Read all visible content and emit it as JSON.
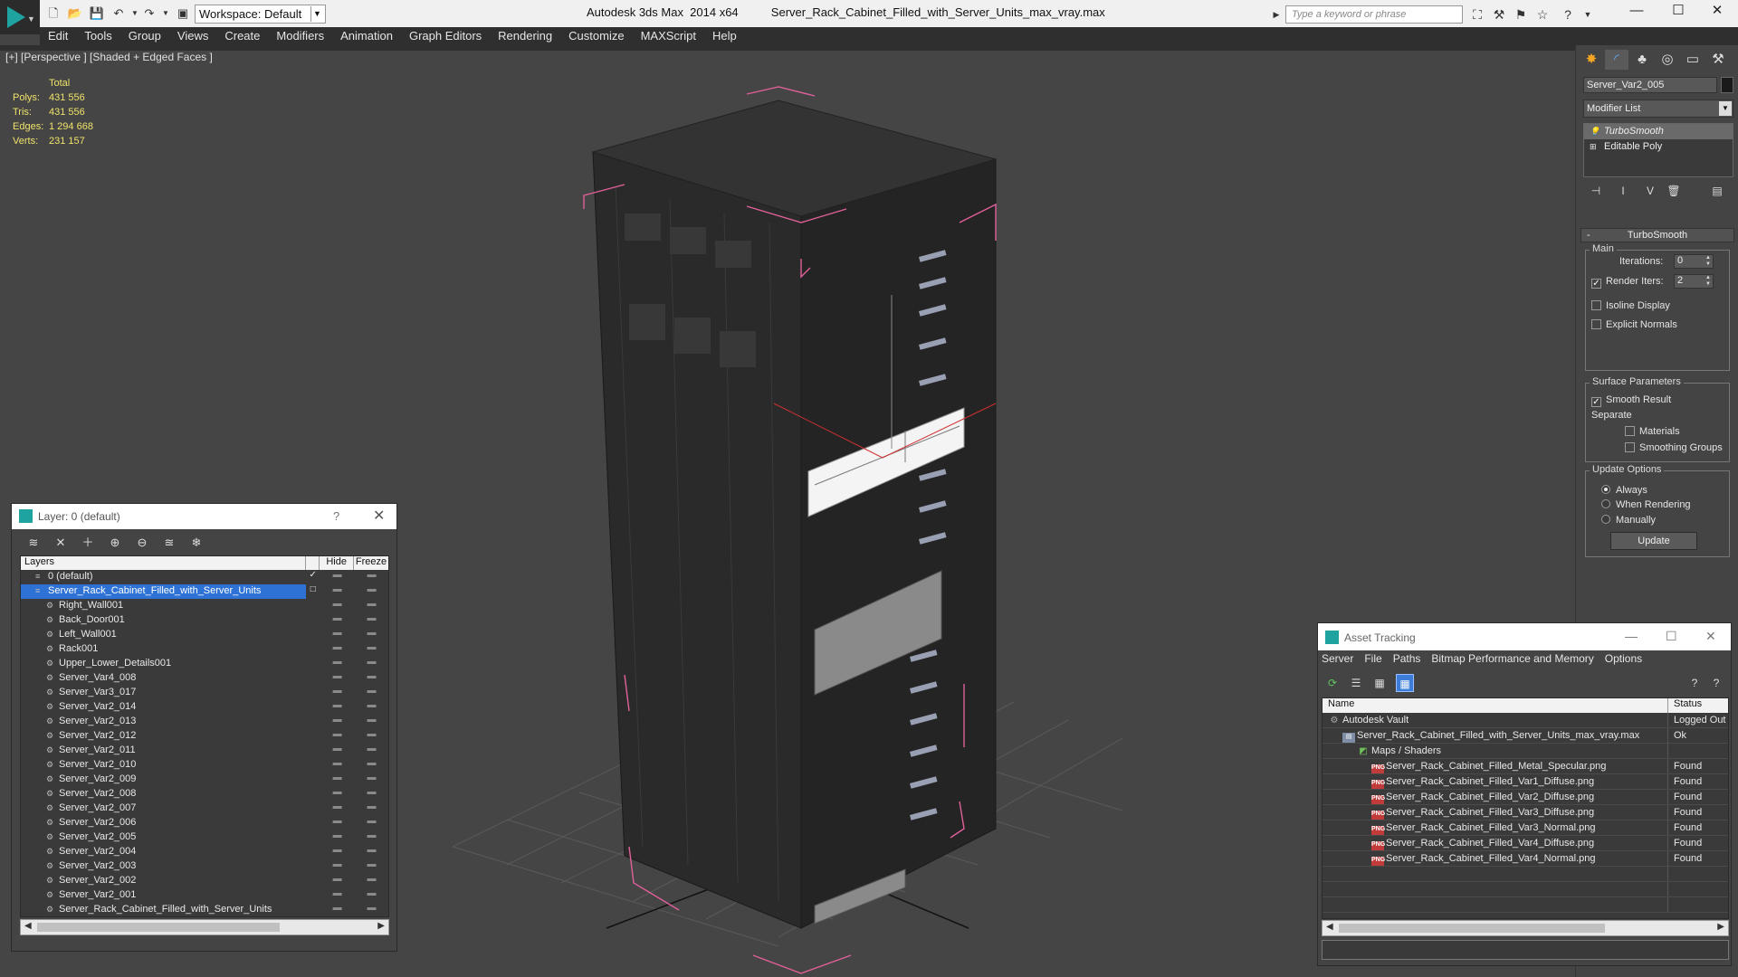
{
  "titlebar": {
    "workspace": "Workspace: Default",
    "app": "Autodesk 3ds Max  2014 x64",
    "file": "Server_Rack_Cabinet_Filled_with_Server_Units_max_vray.max",
    "search_placeholder": "Type a keyword or phrase"
  },
  "menu": [
    "Edit",
    "Tools",
    "Group",
    "Views",
    "Create",
    "Modifiers",
    "Animation",
    "Graph Editors",
    "Rendering",
    "Customize",
    "MAXScript",
    "Help"
  ],
  "viewport": {
    "label": "[+] [Perspective ] [Shaded + Edged Faces ]",
    "stats": {
      "header": "Total",
      "rows": [
        {
          "k": "Polys:",
          "v": "431 556"
        },
        {
          "k": "Tris:",
          "v": "431 556"
        },
        {
          "k": "Edges:",
          "v": "1 294 668"
        },
        {
          "k": "Verts:",
          "v": "231 157"
        }
      ]
    }
  },
  "command_panel": {
    "object_name": "Server_Var2_005",
    "modifier_list": "Modifier List",
    "stack": [
      "TurboSmooth",
      "Editable Poly"
    ],
    "rollout_title": "TurboSmooth",
    "main_label": "Main",
    "iterations_label": "Iterations:",
    "iterations_value": "0",
    "render_iters_label": "Render Iters:",
    "render_iters_value": "2",
    "isoline": "Isoline Display",
    "explicit_normals": "Explicit Normals",
    "surface_params": "Surface Parameters",
    "smooth_result": "Smooth Result",
    "separate": "Separate",
    "materials": "Materials",
    "smoothing_groups": "Smoothing Groups",
    "update_options": "Update Options",
    "always": "Always",
    "when_rendering": "When Rendering",
    "manually": "Manually",
    "update_button": "Update"
  },
  "layer_dialog": {
    "title": "Layer: 0 (default)",
    "help": "?",
    "col_layers": "Layers",
    "col_hide": "Hide",
    "col_freeze": "Freeze",
    "rows": [
      {
        "name": "0 (default)",
        "level": 1,
        "type": "layer",
        "flag": "✓"
      },
      {
        "name": "Server_Rack_Cabinet_Filled_with_Server_Units",
        "level": 1,
        "type": "layer",
        "flag": "□",
        "selected": true
      },
      {
        "name": "Right_Wall001",
        "level": 2,
        "type": "object"
      },
      {
        "name": "Back_Door001",
        "level": 2,
        "type": "object"
      },
      {
        "name": "Left_Wall001",
        "level": 2,
        "type": "object"
      },
      {
        "name": "Rack001",
        "level": 2,
        "type": "object"
      },
      {
        "name": "Upper_Lower_Details001",
        "level": 2,
        "type": "object"
      },
      {
        "name": "Server_Var4_008",
        "level": 2,
        "type": "object"
      },
      {
        "name": "Server_Var3_017",
        "level": 2,
        "type": "object"
      },
      {
        "name": "Server_Var2_014",
        "level": 2,
        "type": "object"
      },
      {
        "name": "Server_Var2_013",
        "level": 2,
        "type": "object"
      },
      {
        "name": "Server_Var2_012",
        "level": 2,
        "type": "object"
      },
      {
        "name": "Server_Var2_011",
        "level": 2,
        "type": "object"
      },
      {
        "name": "Server_Var2_010",
        "level": 2,
        "type": "object"
      },
      {
        "name": "Server_Var2_009",
        "level": 2,
        "type": "object"
      },
      {
        "name": "Server_Var2_008",
        "level": 2,
        "type": "object"
      },
      {
        "name": "Server_Var2_007",
        "level": 2,
        "type": "object"
      },
      {
        "name": "Server_Var2_006",
        "level": 2,
        "type": "object"
      },
      {
        "name": "Server_Var2_005",
        "level": 2,
        "type": "object"
      },
      {
        "name": "Server_Var2_004",
        "level": 2,
        "type": "object"
      },
      {
        "name": "Server_Var2_003",
        "level": 2,
        "type": "object"
      },
      {
        "name": "Server_Var2_002",
        "level": 2,
        "type": "object"
      },
      {
        "name": "Server_Var2_001",
        "level": 2,
        "type": "object"
      },
      {
        "name": "Server_Rack_Cabinet_Filled_with_Server_Units",
        "level": 2,
        "type": "object"
      }
    ]
  },
  "asset_tracking": {
    "title": "Asset Tracking",
    "menu": [
      "Server",
      "File",
      "Paths",
      "Bitmap Performance and Memory",
      "Options"
    ],
    "col_name": "Name",
    "col_status": "Status",
    "rows": [
      {
        "name": "Autodesk Vault",
        "status": "Logged Out",
        "icon": "vault",
        "level": 1
      },
      {
        "name": "Server_Rack_Cabinet_Filled_with_Server_Units_max_vray.max",
        "status": "Ok",
        "icon": "file",
        "level": 2
      },
      {
        "name": "Maps / Shaders",
        "status": "",
        "icon": "maps",
        "level": 3
      },
      {
        "name": "Server_Rack_Cabinet_Filled_Metal_Specular.png",
        "status": "Found",
        "icon": "png",
        "level": 4
      },
      {
        "name": "Server_Rack_Cabinet_Filled_Var1_Diffuse.png",
        "status": "Found",
        "icon": "png",
        "level": 4
      },
      {
        "name": "Server_Rack_Cabinet_Filled_Var2_Diffuse.png",
        "status": "Found",
        "icon": "png",
        "level": 4
      },
      {
        "name": "Server_Rack_Cabinet_Filled_Var3_Diffuse.png",
        "status": "Found",
        "icon": "png",
        "level": 4
      },
      {
        "name": "Server_Rack_Cabinet_Filled_Var3_Normal.png",
        "status": "Found",
        "icon": "png",
        "level": 4
      },
      {
        "name": "Server_Rack_Cabinet_Filled_Var4_Diffuse.png",
        "status": "Found",
        "icon": "png",
        "level": 4
      },
      {
        "name": "Server_Rack_Cabinet_Filled_Var4_Normal.png",
        "status": "Found",
        "icon": "png",
        "level": 4
      }
    ]
  },
  "colors": {
    "selection": "#2d72d4",
    "stats_text": "#f0e26a",
    "bbox_pink": "#e0609a",
    "logo_teal": "#1fa3a0"
  }
}
